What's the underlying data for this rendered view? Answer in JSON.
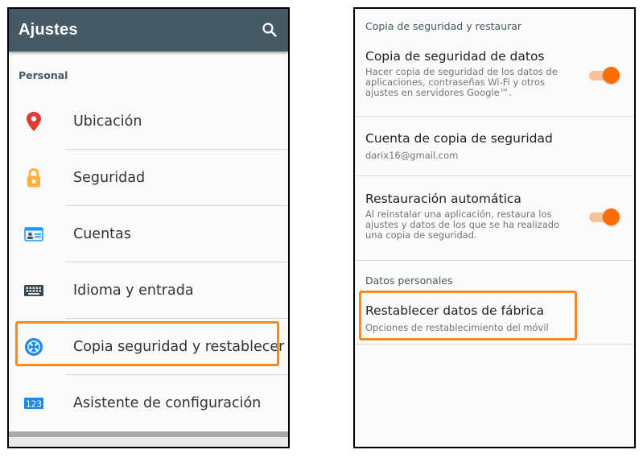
{
  "left": {
    "header": {
      "title": "Ajustes",
      "search_icon": "search-icon"
    },
    "section_label": "Personal",
    "items": [
      {
        "label": "Ubicación",
        "icon": "location-pin-icon",
        "color": "#e53935"
      },
      {
        "label": "Seguridad",
        "icon": "padlock-icon",
        "color": "#fbb13c"
      },
      {
        "label": "Cuentas",
        "icon": "accounts-card-icon",
        "color": "#2196f3"
      },
      {
        "label": "Idioma y entrada",
        "icon": "keyboard-icon",
        "color": "#37474f"
      },
      {
        "label": "Copia seguridad y restablecer",
        "icon": "backup-restore-icon",
        "color": "#1e88e5"
      },
      {
        "label": "Asistente de configuración",
        "icon": "setup-wizard-123-icon",
        "color": "#1e88e5"
      }
    ]
  },
  "right": {
    "section_backup": "Copia de seguridad y restaurar",
    "backup_data": {
      "title": "Copia de seguridad de datos",
      "sub_lines": [
        "Hacer copia de seguridad de los datos de",
        "aplicaciones, contraseñas Wi-Fi y otros",
        "ajustes en servidores Google™."
      ],
      "toggle_on": true
    },
    "backup_account": {
      "title": "Cuenta de copia de seguridad",
      "email": "darix16@gmail.com"
    },
    "auto_restore": {
      "title": "Restauración automática",
      "sub_lines": [
        "Al reinstalar una aplicación, restaura los",
        "ajustes y datos de los que se ha realizado",
        "una copia de seguridad."
      ],
      "toggle_on": true
    },
    "section_personal": "Datos personales",
    "factory_reset": {
      "title": "Restablecer datos de fábrica",
      "sub": "Opciones de restablecimiento del móvil"
    }
  },
  "colors": {
    "header_bg": "#455a64",
    "accent_orange": "#ff6d00",
    "highlight": "#f28b23"
  }
}
